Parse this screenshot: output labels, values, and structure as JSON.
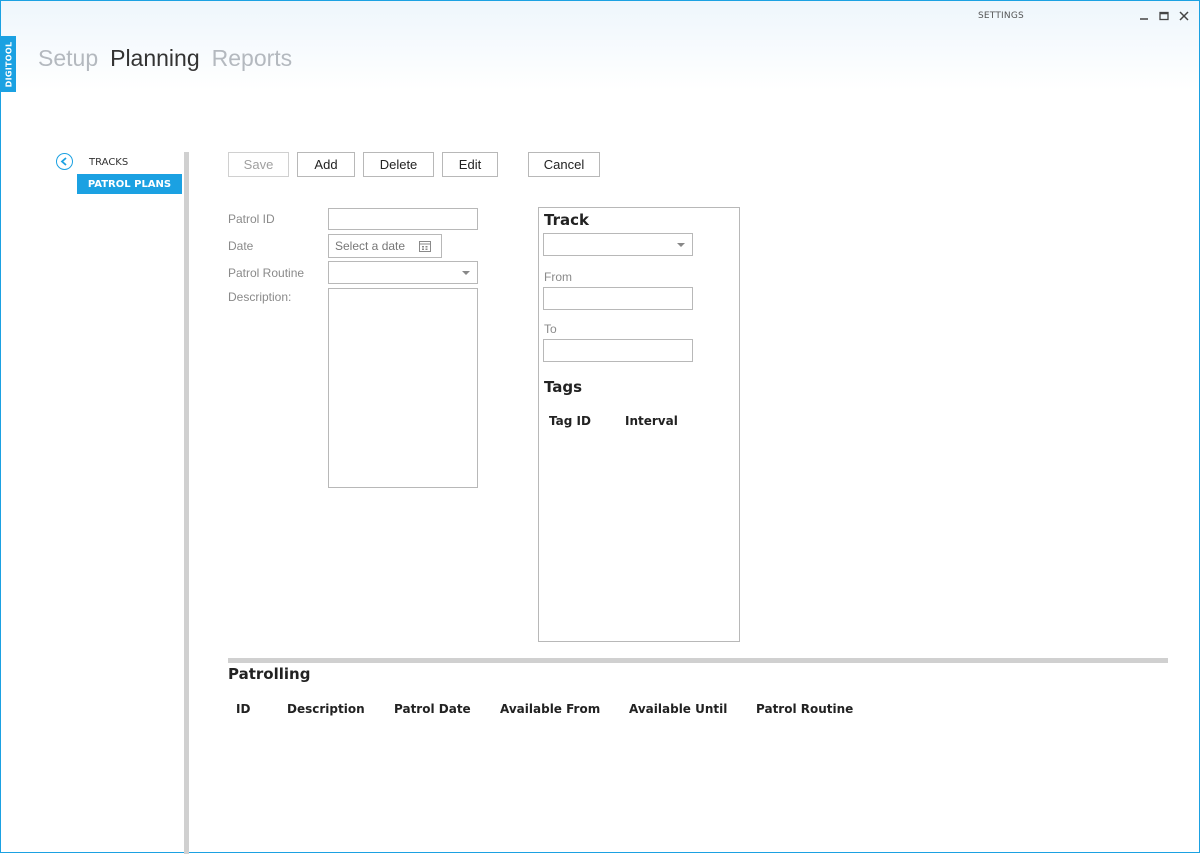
{
  "window": {
    "title": "SETTINGS",
    "app_tag": "DIGITOOL"
  },
  "top_nav": {
    "items": [
      {
        "label": "Setup",
        "active": false
      },
      {
        "label": "Planning",
        "active": true
      },
      {
        "label": "Reports",
        "active": false
      }
    ]
  },
  "sidebar": {
    "items": [
      {
        "label": "TRACKS",
        "selected": false
      },
      {
        "label": "PATROL PLANS",
        "selected": true
      }
    ]
  },
  "toolbar": {
    "save_label": "Save",
    "add_label": "Add",
    "delete_label": "Delete",
    "edit_label": "Edit",
    "cancel_label": "Cancel"
  },
  "form": {
    "patrol_id_label": "Patrol ID",
    "patrol_id_value": "",
    "date_label": "Date",
    "date_placeholder": "Select a date",
    "routine_label": "Patrol Routine",
    "routine_value": "",
    "description_label": "Description:",
    "description_value": ""
  },
  "track_panel": {
    "title": "Track",
    "track_value": "",
    "from_label": "From",
    "from_value": "",
    "to_label": "To",
    "to_value": "",
    "tags_title": "Tags",
    "tags_columns": [
      "Tag ID",
      "Interval"
    ]
  },
  "patrolling": {
    "title": "Patrolling",
    "columns": [
      "ID",
      "Description",
      "Patrol Date",
      "Available From",
      "Available Until",
      "Patrol Routine"
    ]
  },
  "colors": {
    "accent": "#1ba1e2",
    "nav_inactive": "#b4b9bf",
    "label_gray": "#8a8a8a",
    "divider": "#d0d0d0"
  }
}
